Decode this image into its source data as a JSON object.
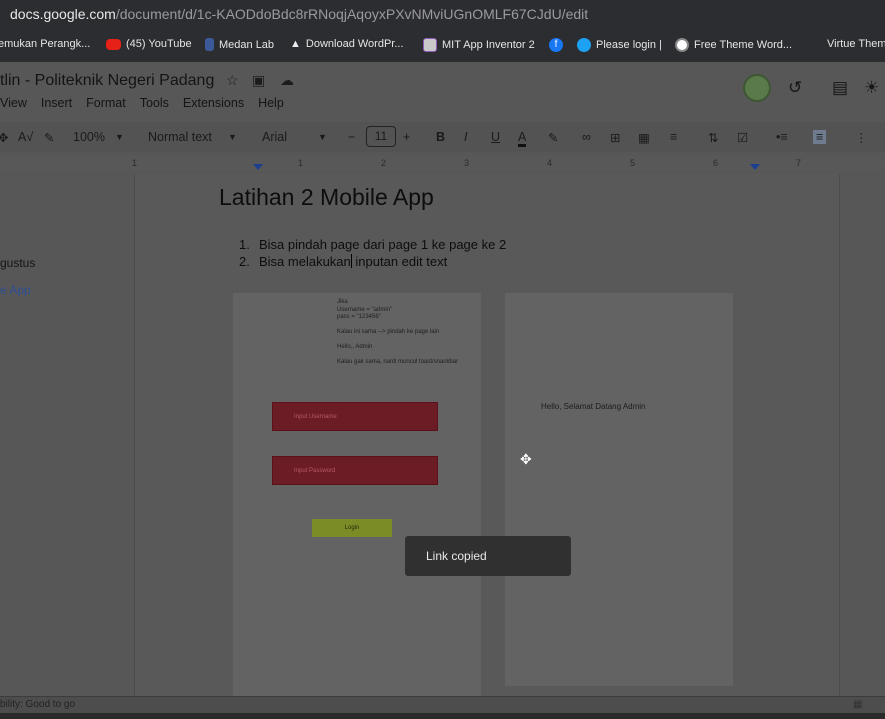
{
  "browser": {
    "url_host": "docs.google.com",
    "url_path": "/document/d/1c-KAODdoBdc8rRNoqjAqoyxPXvNMviUGnOMLF67CJdU/edit",
    "bookmarks": [
      {
        "label": "emukan Perangk..."
      },
      {
        "label": "(45) YouTube"
      },
      {
        "label": "Medan Lab"
      },
      {
        "label": "Download WordPr..."
      },
      {
        "label": "MIT App Inventor 2"
      },
      {
        "label": ""
      },
      {
        "label": "Please login |"
      },
      {
        "label": "Free Theme Word..."
      },
      {
        "label": "Virtue Them"
      }
    ]
  },
  "doc": {
    "title": "tlin - Politeknik Negeri Padang",
    "menu": [
      "View",
      "Insert",
      "Format",
      "Tools",
      "Extensions",
      "Help"
    ]
  },
  "toolbar": {
    "zoom": "100%",
    "style": "Normal text",
    "font": "Arial",
    "font_size": "11",
    "minus": "−",
    "plus": "+",
    "bold": "B",
    "italic": "I",
    "underline": "U",
    "text_color": "A"
  },
  "ruler": {
    "numbers": [
      "1",
      "1",
      "2",
      "3",
      "4",
      "5",
      "6",
      "7"
    ]
  },
  "outline": {
    "items": [
      "gustus",
      "e App"
    ]
  },
  "content": {
    "heading": "Latihan 2 Mobile App",
    "list": [
      {
        "num": "1.",
        "text": "Bisa pindah page dari page 1 ke page ke 2"
      },
      {
        "num": "2.",
        "text_before": "Bisa melakukan",
        "text_after": " inputan edit text"
      }
    ],
    "mock1": {
      "notes": "Jika\nUsername = \"admin\"\npass = \"123456\"\n\nKalau ini sama --> pindah ke page lain\n\nHello,, Admin\n\nKalau gak sama, nanti muncul toast/snackbar",
      "username_placeholder": "Input Username",
      "password_placeholder": "Input Password",
      "login_label": "Login"
    },
    "mock2": {
      "welcome": "Hello, Selamat Datang Admin"
    }
  },
  "toast": {
    "text": "Link copied"
  },
  "status": {
    "text": "bility: Good to go"
  }
}
